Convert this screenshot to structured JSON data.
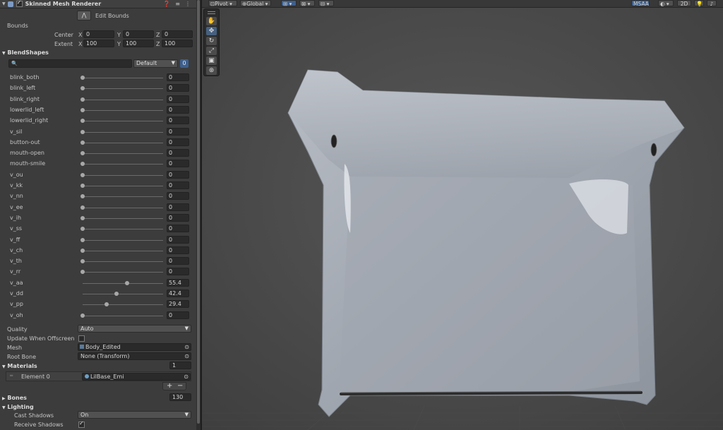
{
  "component": {
    "title": "Skinned Mesh Renderer",
    "enabled": true,
    "help_icon": "help-icon",
    "preset_icon": "sliders-icon",
    "menu_icon": "kebab-icon"
  },
  "edit_bounds_label": "Edit Bounds",
  "bounds": {
    "label": "Bounds",
    "center_label": "Center",
    "extent_label": "Extent",
    "center": {
      "x": "0",
      "y": "0",
      "z": "0"
    },
    "extent": {
      "x": "100",
      "y": "100",
      "z": "100"
    },
    "axis": {
      "x": "X",
      "y": "Y",
      "z": "Z"
    }
  },
  "blendshapes": {
    "header": "BlendShapes",
    "search_placeholder": "",
    "filter_value": "Default",
    "count": "0",
    "items": [
      {
        "name": "blink_both",
        "value": "0"
      },
      {
        "name": "blink_left",
        "value": "0"
      },
      {
        "name": "blink_right",
        "value": "0"
      },
      {
        "name": "lowerlid_left",
        "value": "0"
      },
      {
        "name": "lowerlid_right",
        "value": "0"
      },
      {
        "name": "v_sil",
        "value": "0"
      },
      {
        "name": "button-out",
        "value": "0"
      },
      {
        "name": "mouth-open",
        "value": "0"
      },
      {
        "name": "mouth-smile",
        "value": "0"
      },
      {
        "name": "v_ou",
        "value": "0"
      },
      {
        "name": "v_kk",
        "value": "0"
      },
      {
        "name": "v_nn",
        "value": "0"
      },
      {
        "name": "v_ee",
        "value": "0"
      },
      {
        "name": "v_ih",
        "value": "0"
      },
      {
        "name": "v_ss",
        "value": "0"
      },
      {
        "name": "v_ff",
        "value": "0"
      },
      {
        "name": "v_ch",
        "value": "0"
      },
      {
        "name": "v_th",
        "value": "0"
      },
      {
        "name": "v_rr",
        "value": "0"
      },
      {
        "name": "v_aa",
        "value": "55.4"
      },
      {
        "name": "v_dd",
        "value": "42.4"
      },
      {
        "name": "v_pp",
        "value": "29.4"
      },
      {
        "name": "v_oh",
        "value": "0"
      }
    ],
    "slider_max": 100
  },
  "properties": {
    "quality_label": "Quality",
    "quality_value": "Auto",
    "offscreen_label": "Update When Offscreen",
    "offscreen_checked": false,
    "mesh_label": "Mesh",
    "mesh_value": "Body_Edited",
    "root_bone_label": "Root Bone",
    "root_bone_value": "None (Transform)"
  },
  "materials": {
    "header": "Materials",
    "count": "1",
    "element_label": "Element 0",
    "element_value": "LilBase_Emi",
    "add_label": "+",
    "remove_label": "−"
  },
  "bones": {
    "header": "Bones",
    "count": "130"
  },
  "lighting": {
    "header": "Lighting",
    "cast_shadows_label": "Cast Shadows",
    "cast_shadows_value": "On",
    "receive_shadows_label": "Receive Shadows",
    "receive_shadows_checked": true
  },
  "scene_toolbar": {
    "pivot_label": "Pivot",
    "global_label": "Global",
    "msaa_label": "MSAA",
    "mode_2d_label": "2D"
  },
  "tools": [
    "hand-tool-icon",
    "move-tool-icon",
    "rotate-tool-icon",
    "scale-tool-icon",
    "rect-tool-icon",
    "transform-tool-icon"
  ],
  "colors": {
    "accent": "#3d5f8c",
    "panel": "#3c3c3c",
    "field": "#2a2a2a",
    "mesh": "#9aa2ae"
  }
}
